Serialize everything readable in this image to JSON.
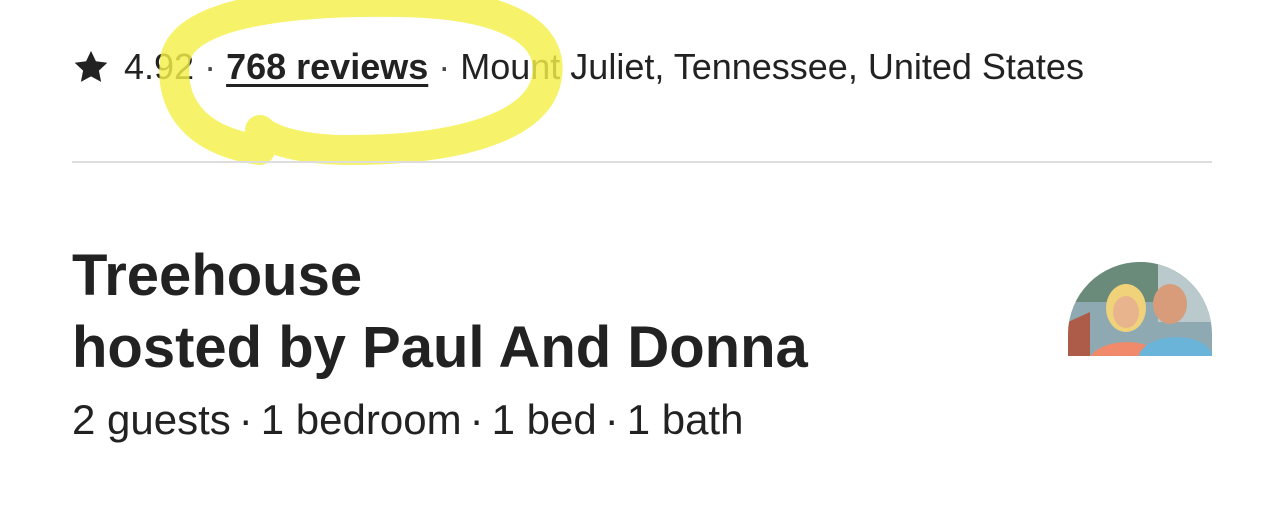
{
  "rating": {
    "star_icon": "star-icon",
    "score": "4.92",
    "separator": "·",
    "reviews_label": "768 reviews",
    "location": "Mount Juliet, Tennessee, United States"
  },
  "listing": {
    "title_line1": "Treehouse",
    "title_line2": "hosted by Paul And Donna",
    "details": [
      "2 guests",
      "1 bedroom",
      "1 bed",
      "1 bath"
    ],
    "detail_separator": "·"
  },
  "host": {
    "avatar_icon": "host-avatar"
  },
  "colors": {
    "text": "#222222",
    "divider": "#dddddd",
    "highlight": "#f4f04a"
  }
}
